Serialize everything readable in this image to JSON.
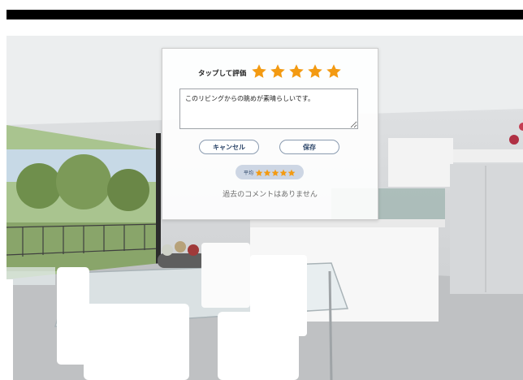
{
  "rating": {
    "label": "タップして評価",
    "stars": 5,
    "max_stars": 5,
    "star_color": "#f39a12"
  },
  "comment": {
    "value": "このリビングからの眺めが素晴らしいです。"
  },
  "buttons": {
    "cancel_label": "キャンセル",
    "save_label": "保存"
  },
  "average": {
    "label": "平均",
    "stars": 5,
    "max_stars": 5
  },
  "history": {
    "empty_text": "過去のコメントはありません"
  },
  "icons": {
    "rating_star": "star-icon",
    "average_star": "star-icon"
  }
}
